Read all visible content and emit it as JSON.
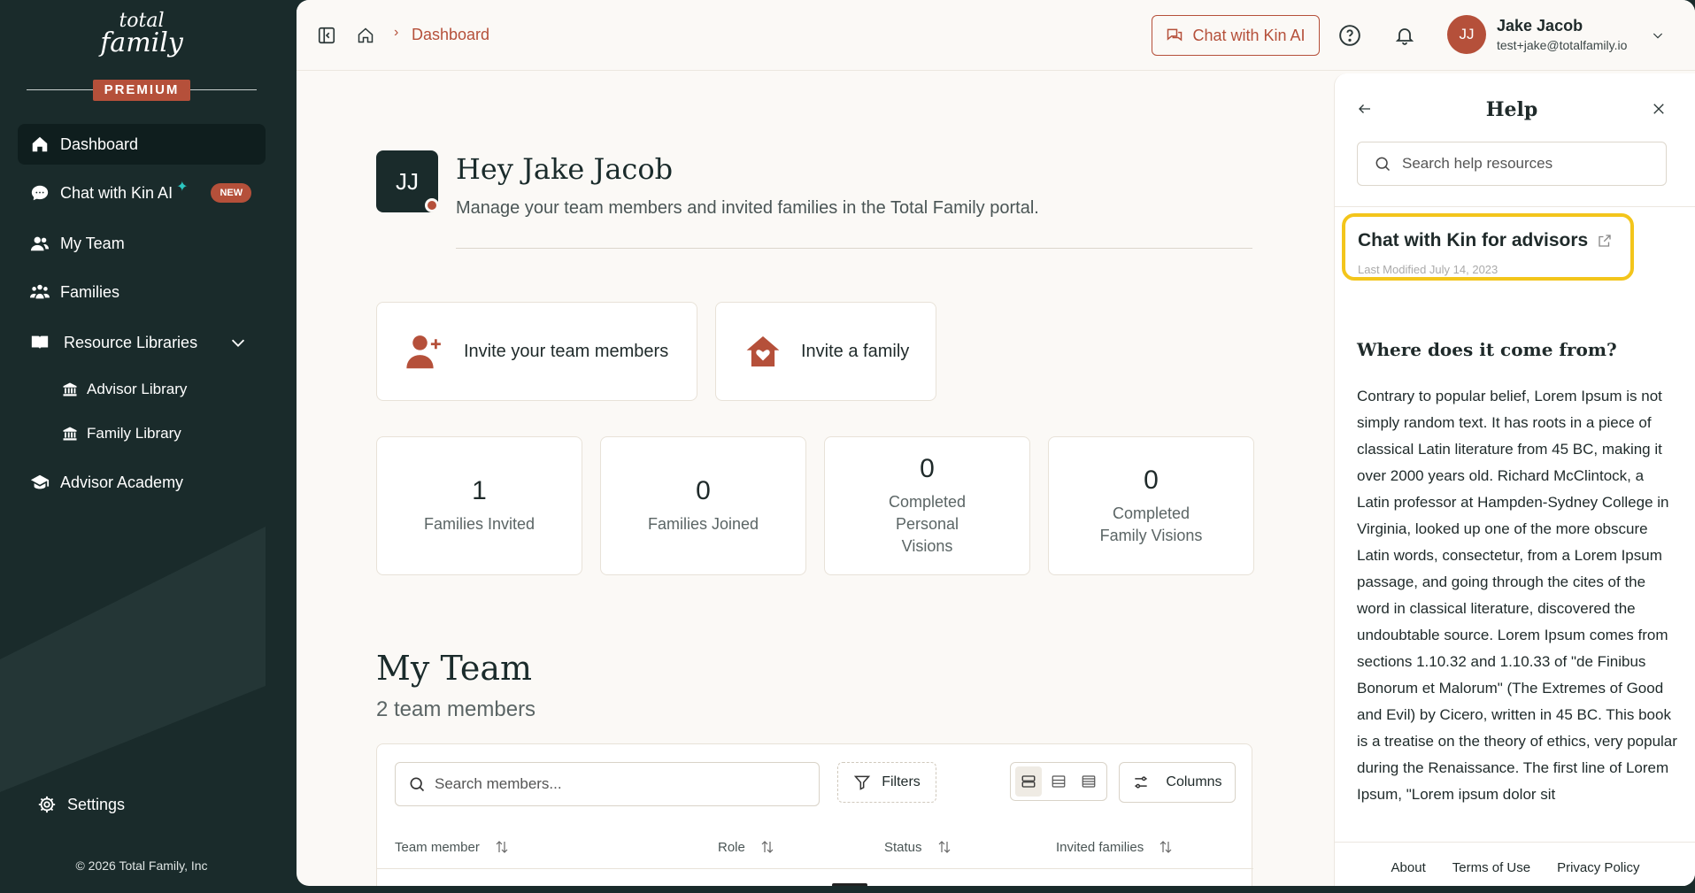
{
  "brand": {
    "logo_line1": "total",
    "logo_line2": "family",
    "tier": "PREMIUM"
  },
  "sidebar": {
    "items": [
      {
        "label": "Dashboard",
        "icon": "home-icon",
        "active": true
      },
      {
        "label": "Chat with Kin AI",
        "icon": "chat-bubble-icon",
        "badge": "NEW"
      },
      {
        "label": "My Team",
        "icon": "users-icon"
      },
      {
        "label": "Families",
        "icon": "family-icon"
      },
      {
        "label": "Resource Libraries",
        "icon": "book-icon",
        "expanded": true
      },
      {
        "label": "Advisor Library",
        "icon": "library-icon"
      },
      {
        "label": "Family Library",
        "icon": "library-icon"
      },
      {
        "label": "Advisor Academy",
        "icon": "graduation-cap-icon"
      }
    ],
    "settings_label": "Settings",
    "copyright": "© 2026 Total Family, Inc"
  },
  "topbar": {
    "breadcrumb_current": "Dashboard",
    "chat_button": "Chat with Kin AI",
    "user": {
      "initials": "JJ",
      "name": "Jake Jacob",
      "email": "test+jake@totalfamily.io"
    }
  },
  "hero": {
    "initials": "JJ",
    "title": "Hey Jake Jacob",
    "subtitle": "Manage your team members and invited families in the Total Family portal."
  },
  "actions": {
    "invite_team": "Invite your team members",
    "invite_family": "Invite a family"
  },
  "stats": [
    {
      "value": "1",
      "label": "Families Invited"
    },
    {
      "value": "0",
      "label": "Families Joined"
    },
    {
      "value": "0",
      "label": "Completed Personal Visions"
    },
    {
      "value": "0",
      "label": "Completed Family Visions"
    }
  ],
  "team": {
    "title": "My Team",
    "subtitle": "2 team members",
    "search_placeholder": "Search members...",
    "filters_label": "Filters",
    "columns_label": "Columns",
    "columns": [
      "Team member",
      "Role",
      "Status",
      "Invited families"
    ]
  },
  "help": {
    "title": "Help",
    "search_placeholder": "Search help resources",
    "card_title": "Chat with Kin for advisors",
    "card_meta": "Last Modified July 14, 2023",
    "section_title": "Where does it come from?",
    "body": "Contrary to popular belief, Lorem Ipsum is not simply random text. It has roots in a piece of classical Latin literature from 45 BC, making it over 2000 years old. Richard McClintock, a Latin professor at Hampden-Sydney College in Virginia, looked up one of the more obscure Latin words, consectetur, from a Lorem Ipsum passage, and going through the cites of the word in classical literature, discovered the undoubtable source. Lorem Ipsum comes from sections 1.10.32 and 1.10.33 of \"de Finibus Bonorum et Malorum\" (The Extremes of Good and Evil) by Cicero, written in 45 BC. This book is a treatise on the theory of ethics, very popular during the Renaissance. The first line of Lorem Ipsum, \"Lorem ipsum dolor sit",
    "footer": [
      "About",
      "Terms of Use",
      "Privacy Policy"
    ]
  },
  "colors": {
    "sidebar_bg": "#1a2b2b",
    "accent": "#b5503a",
    "highlight": "#f3c51b",
    "page_bg": "#fbf9f6"
  }
}
